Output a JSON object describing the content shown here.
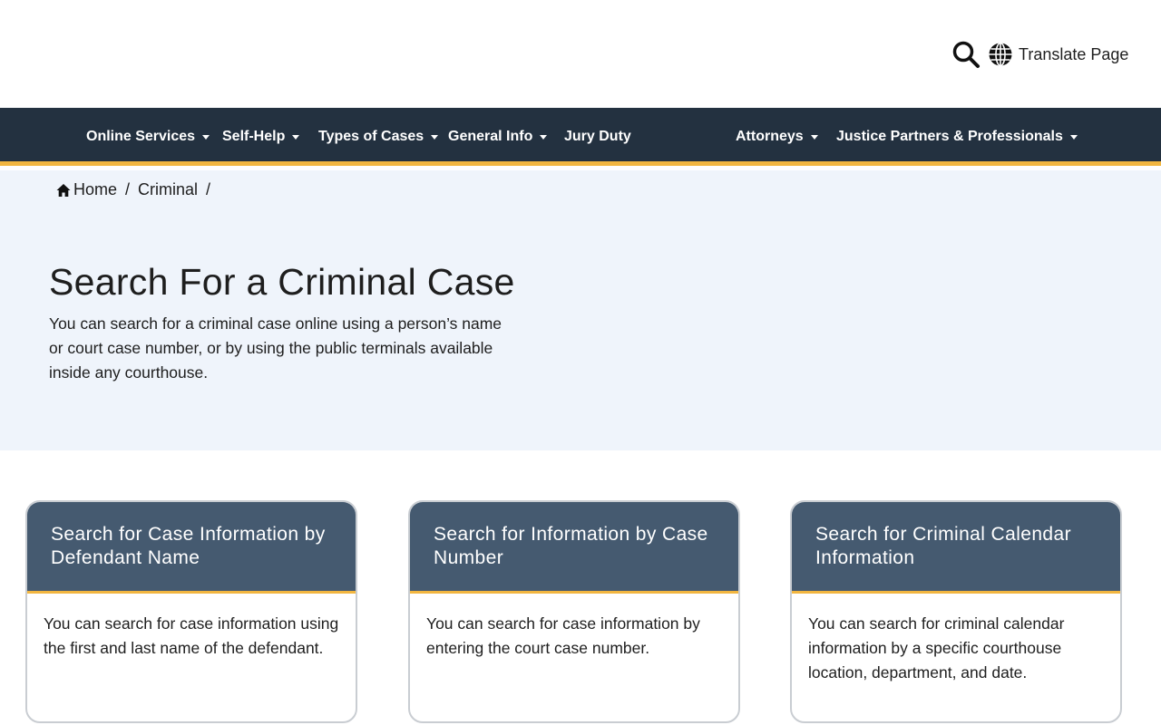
{
  "header": {
    "translate_label": "Translate Page"
  },
  "nav": {
    "items": [
      {
        "label": "Online Services"
      },
      {
        "label": "Self-Help"
      },
      {
        "label": "Types of Cases"
      },
      {
        "label": "General Info"
      },
      {
        "label": "Jury Duty"
      },
      {
        "label": "Attorneys"
      },
      {
        "label": "Justice Partners & Professionals"
      }
    ]
  },
  "breadcrumb": {
    "items": [
      "Home",
      "Criminal"
    ],
    "separator": "/"
  },
  "hero": {
    "title": "Search For a Criminal Case",
    "description": "You can search for a criminal case online using a person’s name or court case number, or by using the public terminals available inside any courthouse."
  },
  "cards": [
    {
      "title": "Search for Case Information by Defendant Name",
      "body": "You can search for case information using the first and last name of the defendant."
    },
    {
      "title": "Search for Information by Case Number",
      "body": "You can search for case information by entering the court case number."
    },
    {
      "title": "Search for Criminal Calendar Information",
      "body": "You can search for criminal calendar information by a specific courthouse location, department, and date."
    }
  ],
  "colors": {
    "nav_bg": "#233140",
    "accent": "#f2b640",
    "hero_bg": "#eff4fb",
    "card_head_bg": "#455a70"
  },
  "icons": [
    "search-icon",
    "globe-icon",
    "home-icon",
    "caret-down-icon"
  ]
}
